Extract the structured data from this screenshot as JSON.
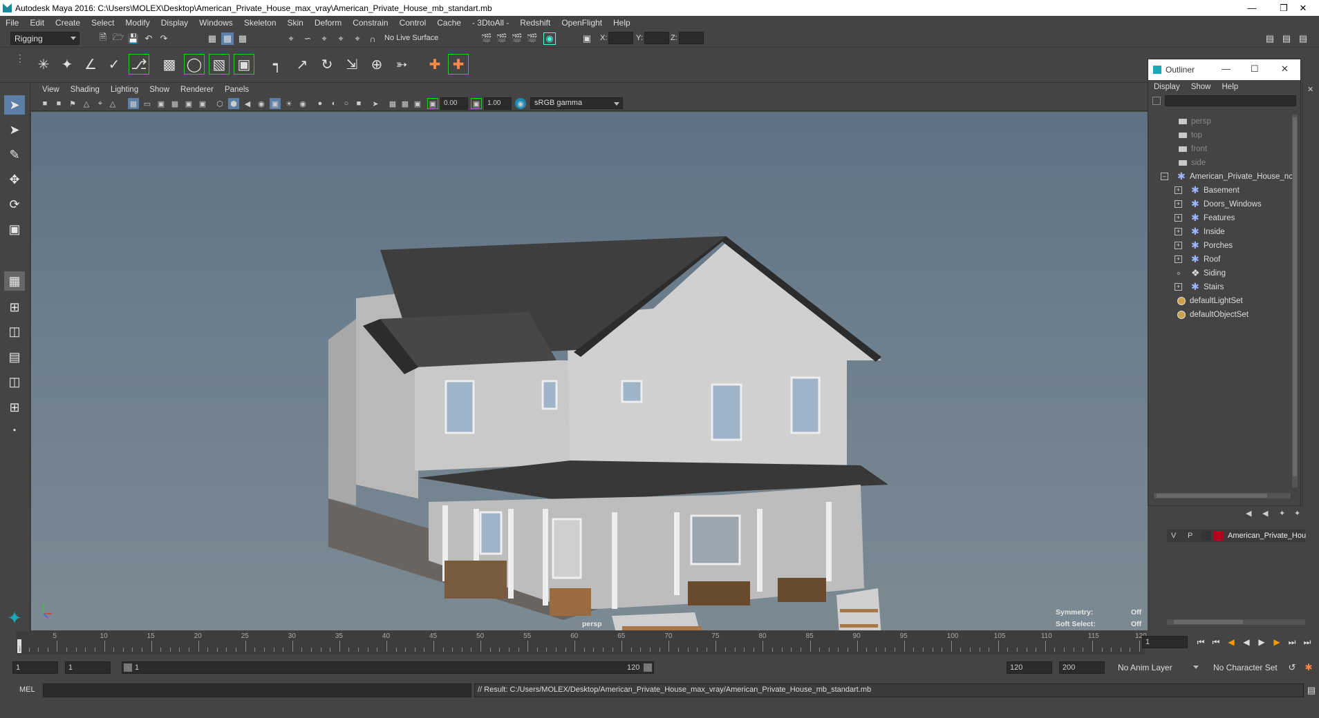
{
  "window": {
    "title": "Autodesk Maya 2016: C:\\Users\\MOLEX\\Desktop\\American_Private_House_max_vray\\American_Private_House_mb_standart.mb"
  },
  "menus": [
    "File",
    "Edit",
    "Create",
    "Select",
    "Modify",
    "Display",
    "Windows",
    "Skeleton",
    "Skin",
    "Deform",
    "Constrain",
    "Control",
    "Cache",
    "- 3DtoAll -",
    "Redshift",
    "OpenFlight",
    "Help"
  ],
  "status_line": {
    "menu_set": "Rigging",
    "live_surface": "No Live Surface",
    "x_label": "X:",
    "y_label": "Y:",
    "z_label": "Z:"
  },
  "viewport": {
    "menus": [
      "View",
      "Shading",
      "Lighting",
      "Show",
      "Renderer",
      "Panels"
    ],
    "exposure": "0.00",
    "gamma": "1.00",
    "color_space": "sRGB gamma",
    "camera_label": "persp",
    "symmetry_label": "Symmetry:",
    "symmetry_value": "Off",
    "soft_select_label": "Soft Select:",
    "soft_select_value": "Off"
  },
  "outliner": {
    "title": "Outliner",
    "menus": [
      "Display",
      "Show",
      "Help"
    ],
    "cameras": [
      "persp",
      "top",
      "front",
      "side"
    ],
    "root": "American_Private_House_nc",
    "children": [
      "Basement",
      "Doors_Windows",
      "Features",
      "Inside",
      "Porches",
      "Roof",
      "Siding",
      "Stairs"
    ],
    "sets": [
      "defaultLightSet",
      "defaultObjectSet"
    ]
  },
  "layer": {
    "v": "V",
    "p": "P",
    "name": "American_Private_Hou",
    "color": "#b3001b"
  },
  "timeline": {
    "ticks": [
      "5",
      "10",
      "15",
      "20",
      "25",
      "30",
      "35",
      "40",
      "45",
      "50",
      "55",
      "60",
      "65",
      "70",
      "75",
      "80",
      "85",
      "90",
      "95",
      "100",
      "105",
      "110",
      "115",
      "120"
    ],
    "first_tick": "1",
    "current_frame": "1"
  },
  "range": {
    "start": "1",
    "playback_start": "1",
    "slider_start": "1",
    "slider_end": "120",
    "playback_end": "120",
    "end": "200",
    "anim_layer": "No Anim Layer",
    "character_set": "No Character Set"
  },
  "command": {
    "mode": "MEL",
    "result": "// Result: C:/Users/MOLEX/Desktop/American_Private_House_max_vray/American_Private_House_mb_standart.mb"
  }
}
